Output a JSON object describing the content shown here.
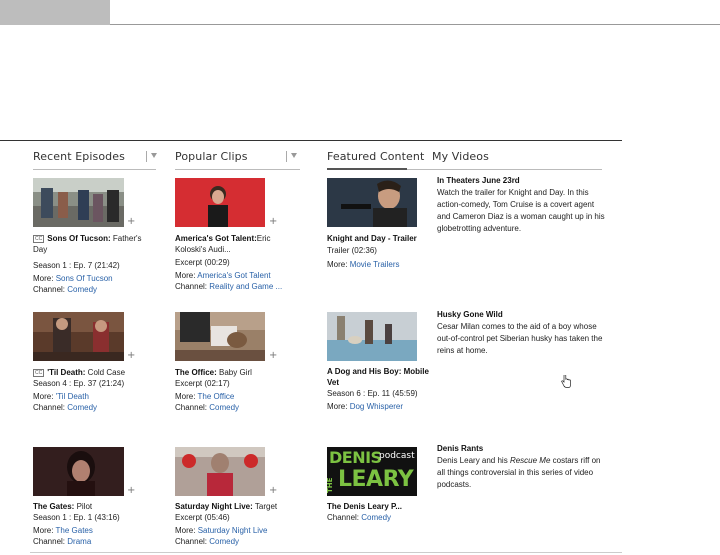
{
  "columns": {
    "recent_episodes": "Recent Episodes",
    "popular_clips": "Popular Clips",
    "featured_content": "Featured Content",
    "my_videos": "My Videos"
  },
  "labels": {
    "more": "More:",
    "channel": "Channel:",
    "cc": "CC"
  },
  "recent": [
    {
      "title": "Sons Of Tucson:",
      "subtitle": "Father's Day",
      "meta": "Season 1 : Ep. 7    (21:42)",
      "more": "Sons Of Tucson",
      "channel": "Comedy"
    },
    {
      "title": "'Til Death:",
      "subtitle": "Cold Case",
      "meta": "Season 4 : Ep. 37   (21:24)",
      "more": "'Til Death",
      "channel": "Comedy"
    },
    {
      "title": "The Gates:",
      "subtitle": "Pilot",
      "meta": "Season 1 : Ep. 1    (43:16)",
      "more": "The Gates",
      "channel": "Drama"
    }
  ],
  "popular": [
    {
      "title": "America's Got Talent:",
      "subtitle": "Eric Koloski's Audi...",
      "meta": "Excerpt   (00:29)",
      "more": "America's Got Talent",
      "channel": "Reality and Game ..."
    },
    {
      "title": "The Office:",
      "subtitle": "Baby Girl",
      "meta": "Excerpt   (02:17)",
      "more": "The Office",
      "channel": "Comedy"
    },
    {
      "title": "Saturday Night Live:",
      "subtitle": "Target",
      "meta": "Excerpt   (05:46)",
      "more": "Saturday Night Live",
      "channel": "Comedy"
    }
  ],
  "featured": [
    {
      "title": "Knight and Day - Trailer",
      "meta": "Trailer   (02:36)",
      "more": "Movie Trailers",
      "desc_title": "In Theaters June 23rd",
      "desc": "Watch the trailer for Knight and Day. In this action-comedy, Tom Cruise is a covert agent and Cameron Diaz is a woman caught up in his globetrotting adventure."
    },
    {
      "title": "A Dog and His Boy: Mobile Vet",
      "meta": "Season 6 : Ep. 11   (45:59)",
      "more": "Dog Whisperer",
      "desc_title": "Husky Gone Wild",
      "desc": "Cesar Milan comes to the aid of a boy whose out-of-control pet Siberian husky has taken the reins at home."
    },
    {
      "title": "The Denis Leary P...",
      "channel": "Comedy",
      "desc_title": "Denis Rants",
      "desc_pre": "Denis Leary and his ",
      "desc_em": "Rescue Me",
      "desc_post": " costars riff on all things controversial in this series of video podcasts.",
      "thumb_text_1": "DENIS",
      "thumb_text_2": "podcast",
      "thumb_text_3": "THE",
      "thumb_text_4": "LEARY"
    }
  ],
  "colors": {
    "link": "#2a62a8",
    "podcast_green": "#7cc242"
  }
}
